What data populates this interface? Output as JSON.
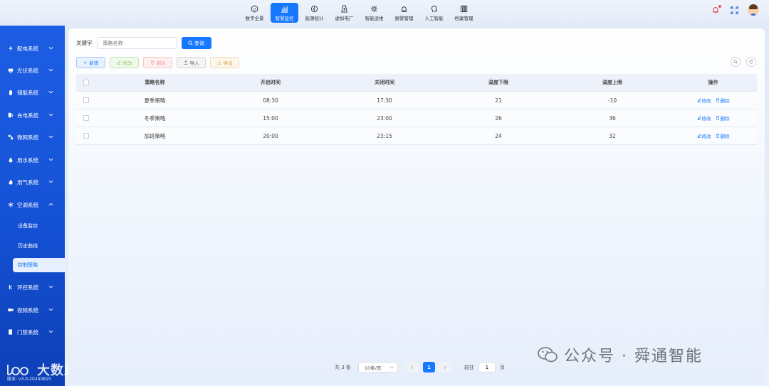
{
  "nav": {
    "items": [
      {
        "label": "数字全景",
        "icon": "panorama-icon",
        "active": false
      },
      {
        "label": "智慧监控",
        "icon": "chart-icon",
        "active": true
      },
      {
        "label": "能源统计",
        "icon": "energy-icon",
        "active": false
      },
      {
        "label": "虚拟电厂",
        "icon": "power-plant-icon",
        "active": false
      },
      {
        "label": "智能运维",
        "icon": "gear-icon",
        "active": false
      },
      {
        "label": "报警管理",
        "icon": "alarm-icon",
        "active": false
      },
      {
        "label": "人工智能",
        "icon": "ai-icon",
        "active": false
      },
      {
        "label": "档案管理",
        "icon": "archive-icon",
        "active": false
      }
    ]
  },
  "sidebar": {
    "items": [
      {
        "label": "配电系统",
        "icon": "lightning-icon"
      },
      {
        "label": "光伏系统",
        "icon": "solar-panel-icon"
      },
      {
        "label": "储能系统",
        "icon": "battery-icon"
      },
      {
        "label": "充电系统",
        "icon": "charger-icon"
      },
      {
        "label": "微网系统",
        "icon": "microgrid-icon"
      },
      {
        "label": "用水系统",
        "icon": "water-drop-icon"
      },
      {
        "label": "用气系统",
        "icon": "flame-icon"
      },
      {
        "label": "空调系统",
        "icon": "snowflake-icon"
      },
      {
        "label": "环控系统",
        "icon": "environment-icon"
      },
      {
        "label": "视频系统",
        "icon": "camera-icon"
      },
      {
        "label": "门禁系统",
        "icon": "door-icon"
      }
    ],
    "sub_items": [
      {
        "label": "设备监控",
        "active": false
      },
      {
        "label": "历史曲线",
        "active": false
      },
      {
        "label": "控制策略",
        "active": true
      }
    ],
    "version": "版本: v3.0-20240815"
  },
  "search": {
    "label": "关键字",
    "placeholder": "策略名称",
    "query_label": "查询"
  },
  "actions": {
    "add": "新增",
    "edit": "修改",
    "delete": "删除",
    "import": "导入",
    "export": "导出"
  },
  "table": {
    "headers": [
      "策略名称",
      "开启时间",
      "关闭时间",
      "温度下限",
      "温度上限",
      "操作"
    ],
    "rows": [
      {
        "name": "夏季策略",
        "start": "08:30",
        "end": "17:30",
        "low": "21",
        "high": "-10"
      },
      {
        "name": "冬季策略",
        "start": "15:00",
        "end": "23:00",
        "low": "26",
        "high": "36"
      },
      {
        "name": "加班策略",
        "start": "20:00",
        "end": "23:15",
        "low": "24",
        "high": "32"
      }
    ],
    "row_edit": "修改",
    "row_delete": "删除"
  },
  "pagination": {
    "total": "共 3 条",
    "page_size": "10条/页",
    "current_page": "1",
    "goto_label": "前往",
    "goto_value": "1",
    "goto_suffix": "页"
  },
  "watermarks": {
    "left": "大数跨境",
    "right": "公众号 · 舜通智能"
  },
  "colors": {
    "primary": "#1677ff",
    "sidebar": "#1a56dc"
  }
}
